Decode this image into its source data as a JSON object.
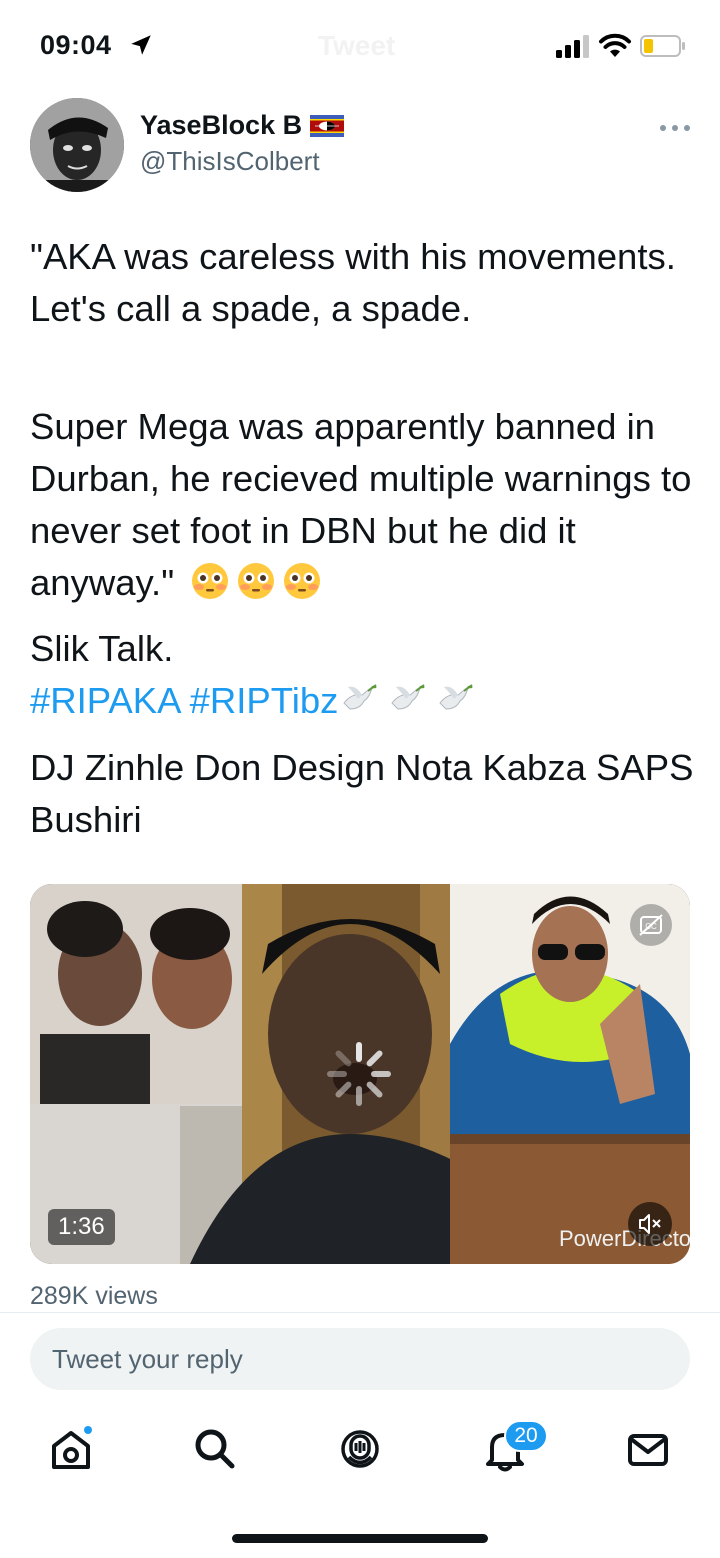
{
  "status_bar": {
    "time": "09:04",
    "faded_title": "Tweet"
  },
  "tweet": {
    "author": {
      "display_name": "YaseBlock B",
      "handle": "@ThisIsColbert",
      "flag_icon": "eswatini-flag-icon"
    },
    "paragraphs": {
      "p1": "\"AKA was careless with his movements. Let's call a spade, a spade.",
      "p2": "Super Mega was apparently banned in Durban, he recieved multiple warnings to never set foot in DBN but he did it anyway.\"",
      "p3_line1": "Slik Talk.",
      "p3_hashtag1": "#RIPAKA",
      "p3_hashtag2": "#RIPTibz",
      "p4": "DJ Zinhle Don Design Nota Kabza SAPS Bushiri"
    },
    "emojis": [
      "flushed-face-icon",
      "flushed-face-icon",
      "flushed-face-icon"
    ],
    "dove_emojis": [
      "dove-icon",
      "dove-icon",
      "dove-icon"
    ],
    "media": {
      "duration": "1:36",
      "watermark": "PowerDirector",
      "muted": true
    },
    "views": "289K views"
  },
  "reply": {
    "placeholder": "Tweet your reply"
  },
  "tab_bar": {
    "notification_count": "20",
    "colors": {
      "accent": "#1d9bf0",
      "text": "#0f1419",
      "secondary": "#536471"
    }
  }
}
